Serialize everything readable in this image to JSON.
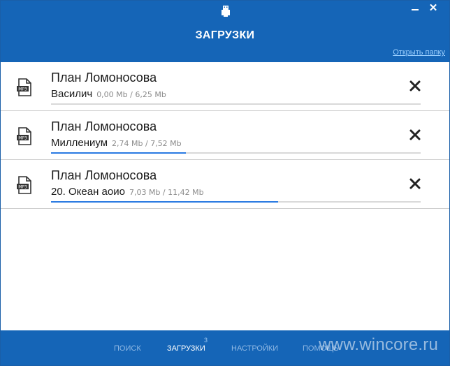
{
  "header": {
    "title": "ЗАГРУЗКИ",
    "open_folder": "Открыть папку",
    "close_glyph": "✕"
  },
  "downloads": [
    {
      "title": "План Ломоносова",
      "track": "Василич",
      "size": "0,00 Mb / 6,25 Mb",
      "progress": 0.0,
      "icon_label": "MP3"
    },
    {
      "title": "План Ломоносова",
      "track": "Миллениум",
      "size": "2,74 Mb / 7,52 Mb",
      "progress": 0.364,
      "icon_label": "MP3"
    },
    {
      "title": "План Ломоносова",
      "track": "20. Океан аоио",
      "size": "7,03 Mb / 11,42 Mb",
      "progress": 0.615,
      "icon_label": "MP3"
    }
  ],
  "nav": {
    "search": "ПОИСК",
    "downloads": "ЗАГРУЗКИ",
    "downloads_badge": "3",
    "settings": "НАСТРОЙКИ",
    "help": "ПОМОЩЬ"
  },
  "watermark": "www.wincore.ru",
  "colors": {
    "accent": "#1565b7",
    "progress": "#2a7ae2"
  }
}
